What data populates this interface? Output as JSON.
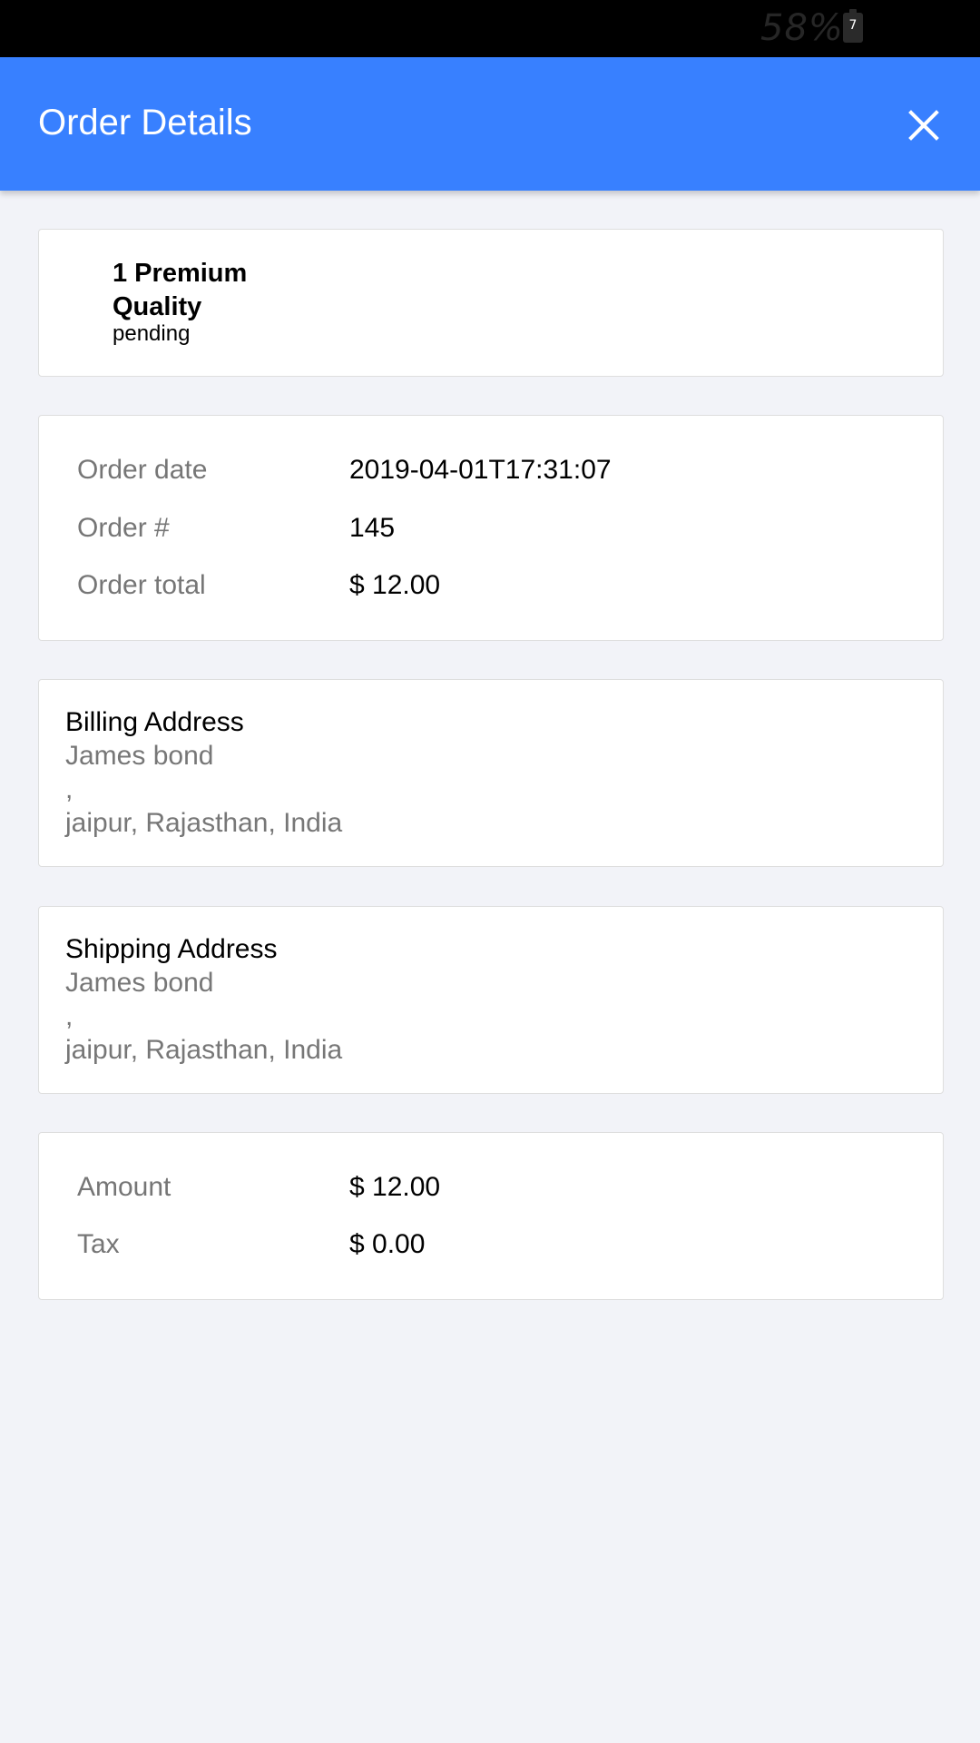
{
  "status_bar": {
    "battery_percent": "58%",
    "battery_icon_digit": "7"
  },
  "header": {
    "title": "Order Details",
    "close_icon": "close-icon"
  },
  "product": {
    "name": "1 Premium Quality",
    "status": "pending"
  },
  "order_info": {
    "rows": [
      {
        "label": "Order date",
        "value": "2019-04-01T17:31:07"
      },
      {
        "label": "Order #",
        "value": "145"
      },
      {
        "label": "Order total",
        "value": "$ 12.00"
      }
    ]
  },
  "billing": {
    "title": "Billing Address",
    "name": "James bond",
    "street": ",",
    "city_line": "jaipur, Rajasthan, India"
  },
  "shipping": {
    "title": "Shipping Address",
    "name": "James bond",
    "street": ",",
    "city_line": "jaipur, Rajasthan, India"
  },
  "totals": {
    "rows": [
      {
        "label": "Amount",
        "value": "$ 12.00"
      },
      {
        "label": "Tax",
        "value": "$ 0.00"
      }
    ]
  },
  "colors": {
    "primary": "#3880ff",
    "background": "#f2f3f8",
    "muted_text": "#767676"
  }
}
